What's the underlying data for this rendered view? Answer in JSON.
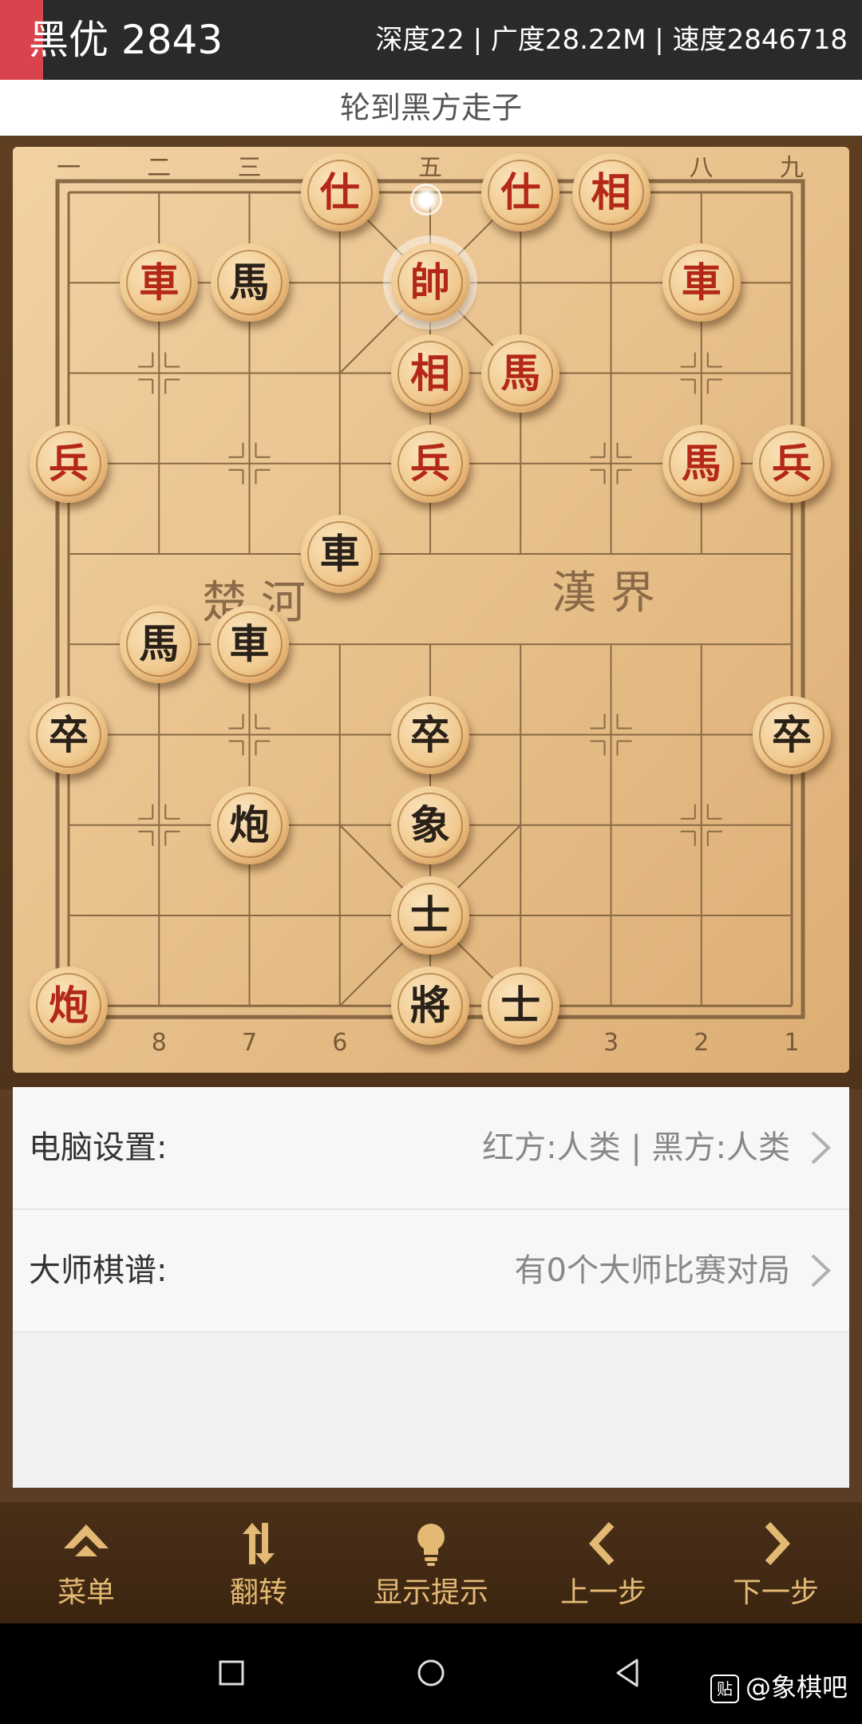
{
  "status": {
    "evaluation": "黑优 2843",
    "stats": "深度22 | 广度28.22M | 速度2846718"
  },
  "turn_text": "轮到黑方走子",
  "board": {
    "river_left": "楚 河",
    "river_right": "漢 界",
    "top_files": [
      "一",
      "二",
      "三",
      "",
      "五",
      "",
      "",
      "八",
      "九"
    ],
    "bottom_files": [
      "",
      "8",
      "7",
      "6",
      "",
      "",
      "3",
      "2",
      "1"
    ],
    "pieces": [
      {
        "char": "仕",
        "side": "red",
        "file": 3,
        "rank": 0
      },
      {
        "char": "仕",
        "side": "red",
        "file": 5,
        "rank": 0
      },
      {
        "char": "相",
        "side": "red",
        "file": 6,
        "rank": 0
      },
      {
        "char": "車",
        "side": "red",
        "file": 1,
        "rank": 1
      },
      {
        "char": "馬",
        "side": "black",
        "file": 2,
        "rank": 1
      },
      {
        "char": "帥",
        "side": "red",
        "file": 4,
        "rank": 1,
        "selected": true
      },
      {
        "char": "車",
        "side": "red",
        "file": 7,
        "rank": 1
      },
      {
        "char": "相",
        "side": "red",
        "file": 4,
        "rank": 2
      },
      {
        "char": "馬",
        "side": "red",
        "file": 5,
        "rank": 2
      },
      {
        "char": "兵",
        "side": "red",
        "file": 0,
        "rank": 3
      },
      {
        "char": "兵",
        "side": "red",
        "file": 4,
        "rank": 3
      },
      {
        "char": "馬",
        "side": "red",
        "file": 7,
        "rank": 3
      },
      {
        "char": "兵",
        "side": "red",
        "file": 8,
        "rank": 3
      },
      {
        "char": "車",
        "side": "black",
        "file": 3,
        "rank": 4
      },
      {
        "char": "馬",
        "side": "black",
        "file": 1,
        "rank": 5
      },
      {
        "char": "車",
        "side": "black",
        "file": 2,
        "rank": 5
      },
      {
        "char": "卒",
        "side": "black",
        "file": 0,
        "rank": 6
      },
      {
        "char": "卒",
        "side": "black",
        "file": 4,
        "rank": 6
      },
      {
        "char": "卒",
        "side": "black",
        "file": 8,
        "rank": 6
      },
      {
        "char": "炮",
        "side": "black",
        "file": 2,
        "rank": 7
      },
      {
        "char": "象",
        "side": "black",
        "file": 4,
        "rank": 7
      },
      {
        "char": "士",
        "side": "black",
        "file": 4,
        "rank": 8
      },
      {
        "char": "炮",
        "side": "red",
        "file": 0,
        "rank": 9
      },
      {
        "char": "將",
        "side": "black",
        "file": 4,
        "rank": 9
      },
      {
        "char": "士",
        "side": "black",
        "file": 5,
        "rank": 9
      }
    ]
  },
  "settings": {
    "computer_label": "电脑设置:",
    "computer_value": "红方:人类 | 黑方:人类",
    "master_label": "大师棋谱:",
    "master_value": "有0个大师比赛对局"
  },
  "nav": {
    "menu": "菜单",
    "flip": "翻转",
    "hint": "显示提示",
    "prev": "上一步",
    "next": "下一步"
  },
  "watermark": {
    "icon_text": "贴",
    "text": "@象棋吧"
  },
  "colors": {
    "red_piece": "#b42818",
    "black_piece": "#2a2118",
    "nav_text": "#e3b974",
    "accent": "#d9434d"
  }
}
